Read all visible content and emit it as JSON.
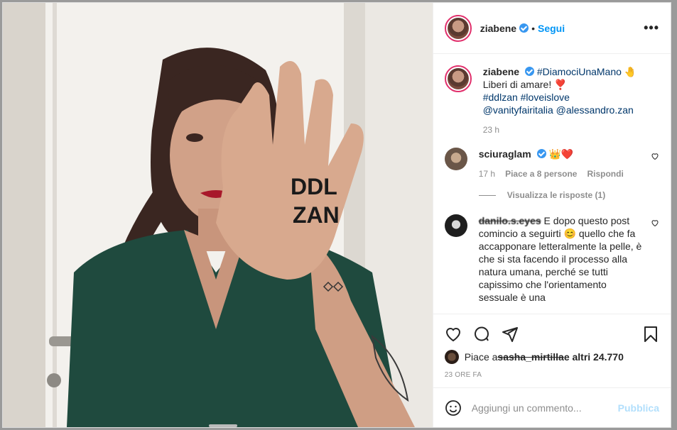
{
  "photo": {
    "hand_text_line1": "DDL",
    "hand_text_line2": "ZAN"
  },
  "header": {
    "username": "ziabene",
    "dot": "•",
    "follow_label": "Segui",
    "more_label": "•••"
  },
  "caption": {
    "username": "ziabene",
    "hashtag1": "#DiamociUnaMano",
    "emoji1": "🤚",
    "line2": "Liberi di amare!",
    "emoji2": "❣️",
    "hashtags": "#ddlzan #loveislove",
    "mentions": "@vanityfairitalia @alessandro.zan",
    "time": "23 h"
  },
  "comments": [
    {
      "username": "sciuraglam",
      "emojis": "👑❤️",
      "time": "17 h",
      "likes": "Piace a 8 persone",
      "reply_label": "Rispondi",
      "view_replies": "Visualizza le risposte (1)"
    },
    {
      "username": "danilo.s.eyes",
      "text": "E dopo questo post comincio a seguirti 😊 quello che fa accapponare letteralmente la pelle, è che si sta facendo il processo alla natura umana, perché se tutti capissimo che l'orientamento sessuale è una"
    }
  ],
  "footer": {
    "likes_prefix": "Piace a ",
    "likes_user": "sasha_mirtilla",
    "likes_suffix": " e altri 24.770",
    "time": "23 ORE FA",
    "comment_placeholder": "Aggiungi un commento...",
    "publish_label": "Pubblica"
  },
  "icons": {
    "like": "heart-icon",
    "comment": "comment-icon",
    "share": "share-icon",
    "save": "bookmark-icon",
    "emoji": "smiley-icon"
  },
  "colors": {
    "accent": "#0095f6",
    "verified": "#3897f0",
    "muted": "#8e8e8e",
    "publish_disabled": "#b2dffc"
  }
}
